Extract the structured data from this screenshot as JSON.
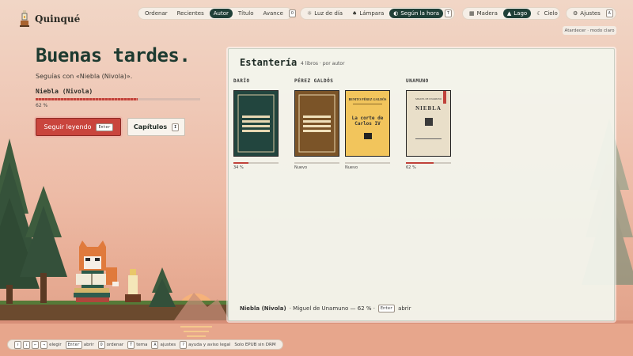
{
  "app": {
    "name": "Quinqué"
  },
  "sort": {
    "items": [
      "Ordenar",
      "Recientes",
      "Autor",
      "Título",
      "Avance"
    ],
    "active": "Autor",
    "key": "O"
  },
  "light": {
    "items": [
      "Luz de día",
      "Lámpara",
      "Según la hora"
    ],
    "active": "Según la hora",
    "key": "T"
  },
  "scene": {
    "items": [
      "Madera",
      "Lago",
      "Cielo"
    ],
    "active": "Lago"
  },
  "settings": {
    "label": "Ajustes",
    "key": "A"
  },
  "theme_note": "Atardecer · modo claro",
  "greeting": {
    "title": "Buenas tardes.",
    "subtitle": "Seguías con «Niebla (Nivola)».",
    "book": "Niebla (Nivola)",
    "progress": 0.62,
    "progress_label": "62 %",
    "continue_label": "Seguir leyendo",
    "continue_key": "Enter",
    "chapters_label": "Capítulos",
    "chapters_key": "I"
  },
  "shelf": {
    "title": "Estantería",
    "count": "4 libros · por autor",
    "groups": [
      {
        "label": "DARÍO",
        "books": [
          {
            "cover": "plain",
            "color": "#22453e",
            "progress": 0.34,
            "status": "34 %"
          }
        ]
      },
      {
        "label": "PÉREZ GALDÓS",
        "books": [
          {
            "cover": "plain",
            "color": "#7b5428",
            "progress": 0,
            "status": "Nuevo"
          },
          {
            "cover": "titled",
            "color": "#f2c55c",
            "author": "BENITO PÉREZ GALDÓS",
            "title": "La corte de Carlos IV",
            "progress": 0,
            "status": "Nuevo"
          }
        ]
      },
      {
        "label": "UNAMUNO",
        "books": [
          {
            "cover": "niebla",
            "color": "#e9dfc9",
            "author": "MIGUEL DE UNAMUNO",
            "title": "NIEBLA",
            "progress": 0.62,
            "status": "62 %"
          }
        ]
      }
    ],
    "footer": {
      "book": "Niebla (Nivola)",
      "rest": "· Miguel de Unamuno — 62 % ·",
      "key": "Enter",
      "action": "abrir"
    }
  },
  "statusbar": {
    "arrows": [
      "↑",
      "↓",
      "←",
      "→"
    ],
    "items": [
      {
        "key": "",
        "label": "elegir"
      },
      {
        "key": "Enter",
        "label": "abrir"
      },
      {
        "key": "O",
        "label": "ordenar"
      },
      {
        "key": "T",
        "label": "tema"
      },
      {
        "key": "A",
        "label": "ajustes"
      },
      {
        "key": "?",
        "label": "ayuda y aviso legal"
      }
    ],
    "note": "Solo EPUB sin DRM"
  }
}
